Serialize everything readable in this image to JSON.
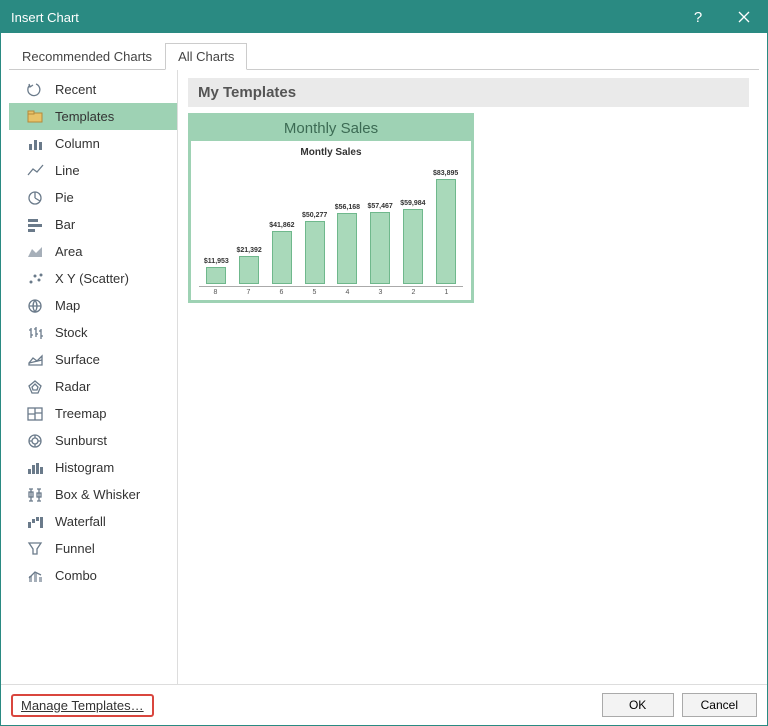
{
  "window": {
    "title": "Insert Chart"
  },
  "tabs": {
    "recommended": "Recommended Charts",
    "all": "All Charts"
  },
  "sidebar": {
    "items": [
      {
        "label": "Recent",
        "icon": "recent-icon"
      },
      {
        "label": "Templates",
        "icon": "templates-icon",
        "selected": true
      },
      {
        "label": "Column",
        "icon": "column-icon"
      },
      {
        "label": "Line",
        "icon": "line-icon"
      },
      {
        "label": "Pie",
        "icon": "pie-icon"
      },
      {
        "label": "Bar",
        "icon": "bar-icon"
      },
      {
        "label": "Area",
        "icon": "area-icon"
      },
      {
        "label": "X Y (Scatter)",
        "icon": "scatter-icon"
      },
      {
        "label": "Map",
        "icon": "map-icon"
      },
      {
        "label": "Stock",
        "icon": "stock-icon"
      },
      {
        "label": "Surface",
        "icon": "surface-icon"
      },
      {
        "label": "Radar",
        "icon": "radar-icon"
      },
      {
        "label": "Treemap",
        "icon": "treemap-icon"
      },
      {
        "label": "Sunburst",
        "icon": "sunburst-icon"
      },
      {
        "label": "Histogram",
        "icon": "histogram-icon"
      },
      {
        "label": "Box & Whisker",
        "icon": "boxwhisker-icon"
      },
      {
        "label": "Waterfall",
        "icon": "waterfall-icon"
      },
      {
        "label": "Funnel",
        "icon": "funnel-icon"
      },
      {
        "label": "Combo",
        "icon": "combo-icon"
      }
    ]
  },
  "main": {
    "section_title": "My Templates",
    "template": {
      "name": "Monthly Sales",
      "chart_title": "Montly Sales"
    }
  },
  "footer": {
    "manage": "Manage Templates…",
    "ok": "OK",
    "cancel": "Cancel"
  },
  "chart_data": {
    "type": "bar",
    "title": "Montly Sales",
    "categories": [
      "8",
      "7",
      "6",
      "5",
      "4",
      "3",
      "2",
      "1"
    ],
    "values": [
      11953,
      21392,
      41862,
      50277,
      56168,
      57467,
      59984,
      83895
    ],
    "value_labels": [
      "$11,953",
      "$21,392",
      "$41,862",
      "$50,277",
      "$56,168",
      "$57,467",
      "$59,984",
      "$83,895"
    ],
    "xlabel": "",
    "ylabel": "",
    "ylim": [
      0,
      90000
    ]
  }
}
